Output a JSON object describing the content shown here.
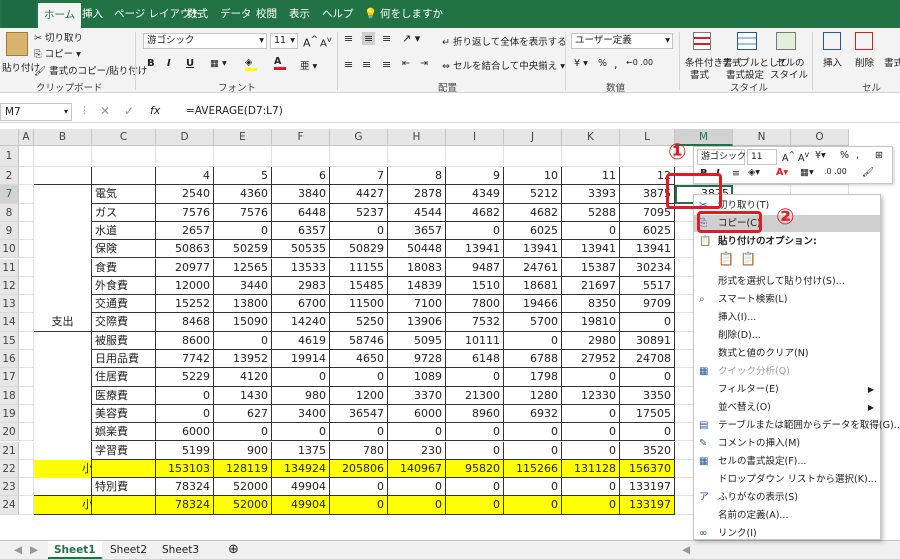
{
  "tabs": [
    "ホーム",
    "挿入",
    "ページ レイアウト",
    "数式",
    "データ",
    "校閲",
    "表示",
    "ヘルプ",
    "何をしますか"
  ],
  "ribbon": {
    "paste": "貼り付け",
    "cut": "切り取り",
    "copy": "コピー",
    "format_copy": "書式のコピー/貼り付け",
    "clipboard_label": "クリップボード",
    "font_name": "游ゴシック",
    "font_size": "11",
    "font_label": "フォント",
    "wrap": "折り返して全体を表示する",
    "merge": "セルを結合して中央揃え",
    "align_label": "配置",
    "num_format": "ユーザー定義",
    "num_label": "数値",
    "cond": "条件付き書式",
    "cond2": "書式",
    "table_fmt": "テーブルとして",
    "table_fmt2": "書式設定",
    "cell_style": "セルの",
    "cell_style2": "スタイル",
    "style_label": "スタイル",
    "insert": "挿入",
    "delete": "削除",
    "format": "書式",
    "cell_label": "セル"
  },
  "formula_bar": {
    "name_box": "M7",
    "fx": "fx",
    "formula": "=AVERAGE(D7:L7)"
  },
  "columns": [
    "A",
    "B",
    "C",
    "D",
    "E",
    "F",
    "G",
    "H",
    "I",
    "J",
    "K",
    "L",
    "M",
    "N",
    "O"
  ],
  "rows": [
    {
      "n": "1",
      "cells": [
        "",
        "",
        "",
        "",
        "",
        "",
        "",
        "",
        "",
        "",
        "",
        "",
        ""
      ]
    },
    {
      "n": "2",
      "cells": [
        "",
        "",
        "4",
        "5",
        "6",
        "7",
        "8",
        "9",
        "10",
        "11",
        "12",
        "平均"
      ]
    },
    {
      "n": "7",
      "cells": [
        "",
        "電気",
        "2540",
        "4360",
        "3840",
        "4427",
        "2878",
        "4349",
        "5212",
        "3393",
        "3875",
        "3875"
      ]
    },
    {
      "n": "8",
      "cells": [
        "",
        "ガス",
        "7576",
        "7576",
        "6448",
        "5237",
        "4544",
        "4682",
        "4682",
        "5288",
        "7095",
        ""
      ]
    },
    {
      "n": "9",
      "cells": [
        "",
        "水道",
        "2657",
        "0",
        "6357",
        "0",
        "3657",
        "0",
        "6025",
        "0",
        "6025",
        ""
      ]
    },
    {
      "n": "10",
      "cells": [
        "",
        "保険",
        "50863",
        "50259",
        "50535",
        "50829",
        "50448",
        "13941",
        "13941",
        "13941",
        "13941",
        ""
      ]
    },
    {
      "n": "11",
      "cells": [
        "",
        "食費",
        "20977",
        "12565",
        "13533",
        "11155",
        "18083",
        "9487",
        "24761",
        "15387",
        "30234",
        ""
      ]
    },
    {
      "n": "12",
      "cells": [
        "",
        "外食費",
        "12000",
        "3440",
        "2983",
        "15485",
        "14839",
        "1510",
        "18681",
        "21697",
        "5517",
        ""
      ]
    },
    {
      "n": "13",
      "cells": [
        "",
        "交通費",
        "15252",
        "13800",
        "6700",
        "11500",
        "7100",
        "7800",
        "19466",
        "8350",
        "9709",
        ""
      ]
    },
    {
      "n": "14",
      "cells": [
        "支出",
        "交際費",
        "8468",
        "15090",
        "14240",
        "5250",
        "13906",
        "7532",
        "5700",
        "19810",
        "0",
        ""
      ]
    },
    {
      "n": "15",
      "cells": [
        "",
        "被服費",
        "8600",
        "0",
        "4619",
        "58746",
        "5095",
        "10111",
        "0",
        "2980",
        "30891",
        ""
      ]
    },
    {
      "n": "16",
      "cells": [
        "",
        "日用品費",
        "7742",
        "13952",
        "19914",
        "4650",
        "9728",
        "6148",
        "6788",
        "27952",
        "24708",
        ""
      ]
    },
    {
      "n": "17",
      "cells": [
        "",
        "住居費",
        "5229",
        "4120",
        "0",
        "0",
        "1089",
        "0",
        "1798",
        "0",
        "0",
        ""
      ]
    },
    {
      "n": "18",
      "cells": [
        "",
        "医療費",
        "0",
        "1430",
        "980",
        "1200",
        "3370",
        "21300",
        "1280",
        "12330",
        "3350",
        ""
      ]
    },
    {
      "n": "19",
      "cells": [
        "",
        "美容費",
        "0",
        "627",
        "3400",
        "36547",
        "6000",
        "8960",
        "6932",
        "0",
        "17505",
        ""
      ]
    },
    {
      "n": "20",
      "cells": [
        "",
        "娯楽費",
        "6000",
        "0",
        "0",
        "0",
        "0",
        "0",
        "0",
        "0",
        "0",
        ""
      ]
    },
    {
      "n": "21",
      "cells": [
        "",
        "学習費",
        "5199",
        "900",
        "1375",
        "780",
        "230",
        "0",
        "0",
        "0",
        "3520",
        ""
      ]
    },
    {
      "n": "22",
      "cells": [
        "小計",
        "",
        "153103",
        "128119",
        "134924",
        "205806",
        "140967",
        "95820",
        "115266",
        "131128",
        "156370",
        ""
      ]
    },
    {
      "n": "23",
      "cells": [
        "",
        "特別費",
        "78324",
        "52000",
        "49904",
        "0",
        "0",
        "0",
        "0",
        "0",
        "133197",
        ""
      ]
    },
    {
      "n": "24",
      "cells": [
        "小計",
        "",
        "78324",
        "52000",
        "49904",
        "0",
        "0",
        "0",
        "0",
        "0",
        "133197",
        ""
      ]
    }
  ],
  "sheets": [
    "Sheet1",
    "Sheet2",
    "Sheet3"
  ],
  "mini_toolbar": {
    "font": "游ゴシック",
    "size": "11",
    "percent": "%"
  },
  "context_menu": [
    {
      "label": "切り取り(T)",
      "icon": "✂",
      "dis": false
    },
    {
      "label": "コピー(C)",
      "icon": "⎘",
      "dis": false,
      "hl": true
    },
    {
      "label": "貼り付けのオプション:",
      "icon": "📋",
      "dis": false,
      "bold": true
    },
    {
      "label": "",
      "icon": "",
      "dis": false
    },
    {
      "label": "形式を選択して貼り付け(S)...",
      "icon": "",
      "dis": false
    },
    {
      "label": "スマート検索(L)",
      "icon": "⌕",
      "dis": false
    },
    {
      "label": "挿入(I)...",
      "icon": "",
      "dis": false
    },
    {
      "label": "削除(D)...",
      "icon": "",
      "dis": false
    },
    {
      "label": "数式と値のクリア(N)",
      "icon": "",
      "dis": false
    },
    {
      "label": "クイック分析(Q)",
      "icon": "▦",
      "dis": true
    },
    {
      "label": "フィルター(E)",
      "icon": "",
      "dis": false,
      "arrow": true
    },
    {
      "label": "並べ替え(O)",
      "icon": "",
      "dis": false,
      "arrow": true
    },
    {
      "label": "テーブルまたは範囲からデータを取得(G)...",
      "icon": "▤",
      "dis": false
    },
    {
      "label": "コメントの挿入(M)",
      "icon": "✎",
      "dis": false
    },
    {
      "label": "セルの書式設定(F)...",
      "icon": "▦",
      "dis": false
    },
    {
      "label": "ドロップダウン リストから選択(K)...",
      "icon": "",
      "dis": false
    },
    {
      "label": "ふりがなの表示(S)",
      "icon": "ア",
      "dis": false
    },
    {
      "label": "名前の定義(A)...",
      "icon": "",
      "dis": false
    },
    {
      "label": "リンク(I)",
      "icon": "∞",
      "dis": false
    }
  ],
  "annotations": {
    "one": "①",
    "two": "②"
  },
  "colors": {
    "excel_green": "#217346",
    "highlight": "#ffff00",
    "red": "#e01b24"
  }
}
